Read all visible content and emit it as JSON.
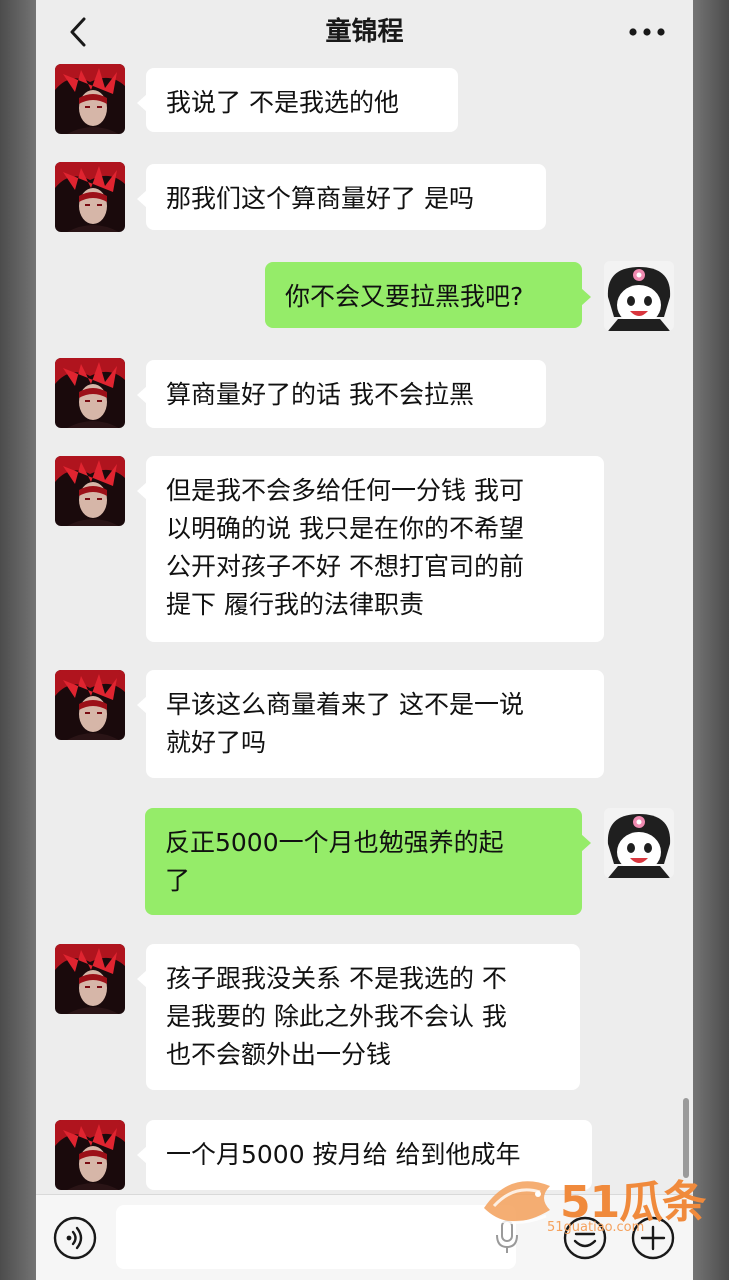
{
  "header": {
    "title": "童锦程",
    "back_icon": "chevron-left-icon",
    "more_icon": "more-dots-icon"
  },
  "messages": [
    {
      "side": "in",
      "text": "我说了 不是我选的他"
    },
    {
      "side": "in",
      "text": "那我们这个算商量好了 是吗"
    },
    {
      "side": "out",
      "text": "你不会又要拉黑我吧?"
    },
    {
      "side": "in",
      "text": "算商量好了的话 我不会拉黑"
    },
    {
      "side": "in",
      "text": "但是我不会多给任何一分钱 我可\n以明确的说 我只是在你的不希望\n公开对孩子不好 不想打官司的前\n提下 履行我的法律职责"
    },
    {
      "side": "in",
      "text": "早该这么商量着来了 这不是一说\n就好了吗"
    },
    {
      "side": "out",
      "text": "反正5000一个月也勉强养的起\n了"
    },
    {
      "side": "in",
      "text": "孩子跟我没关系 不是我选的 不\n是我要的 除此之外我不会认 我\n也不会额外出一分钱"
    },
    {
      "side": "in",
      "text": "一个月5000 按月给 给到他成年"
    }
  ],
  "input_bar": {
    "voice_icon": "voice-icon",
    "mic_icon": "mic-icon",
    "emoji_icon": "emoji-icon",
    "plus_icon": "plus-icon"
  },
  "watermark": {
    "text": "51瓜条",
    "url": "51guatiao.com"
  },
  "colors": {
    "background": "#ededed",
    "incoming_bubble": "#ffffff",
    "outgoing_bubble": "#95ec69",
    "watermark": "#f08a3c"
  }
}
